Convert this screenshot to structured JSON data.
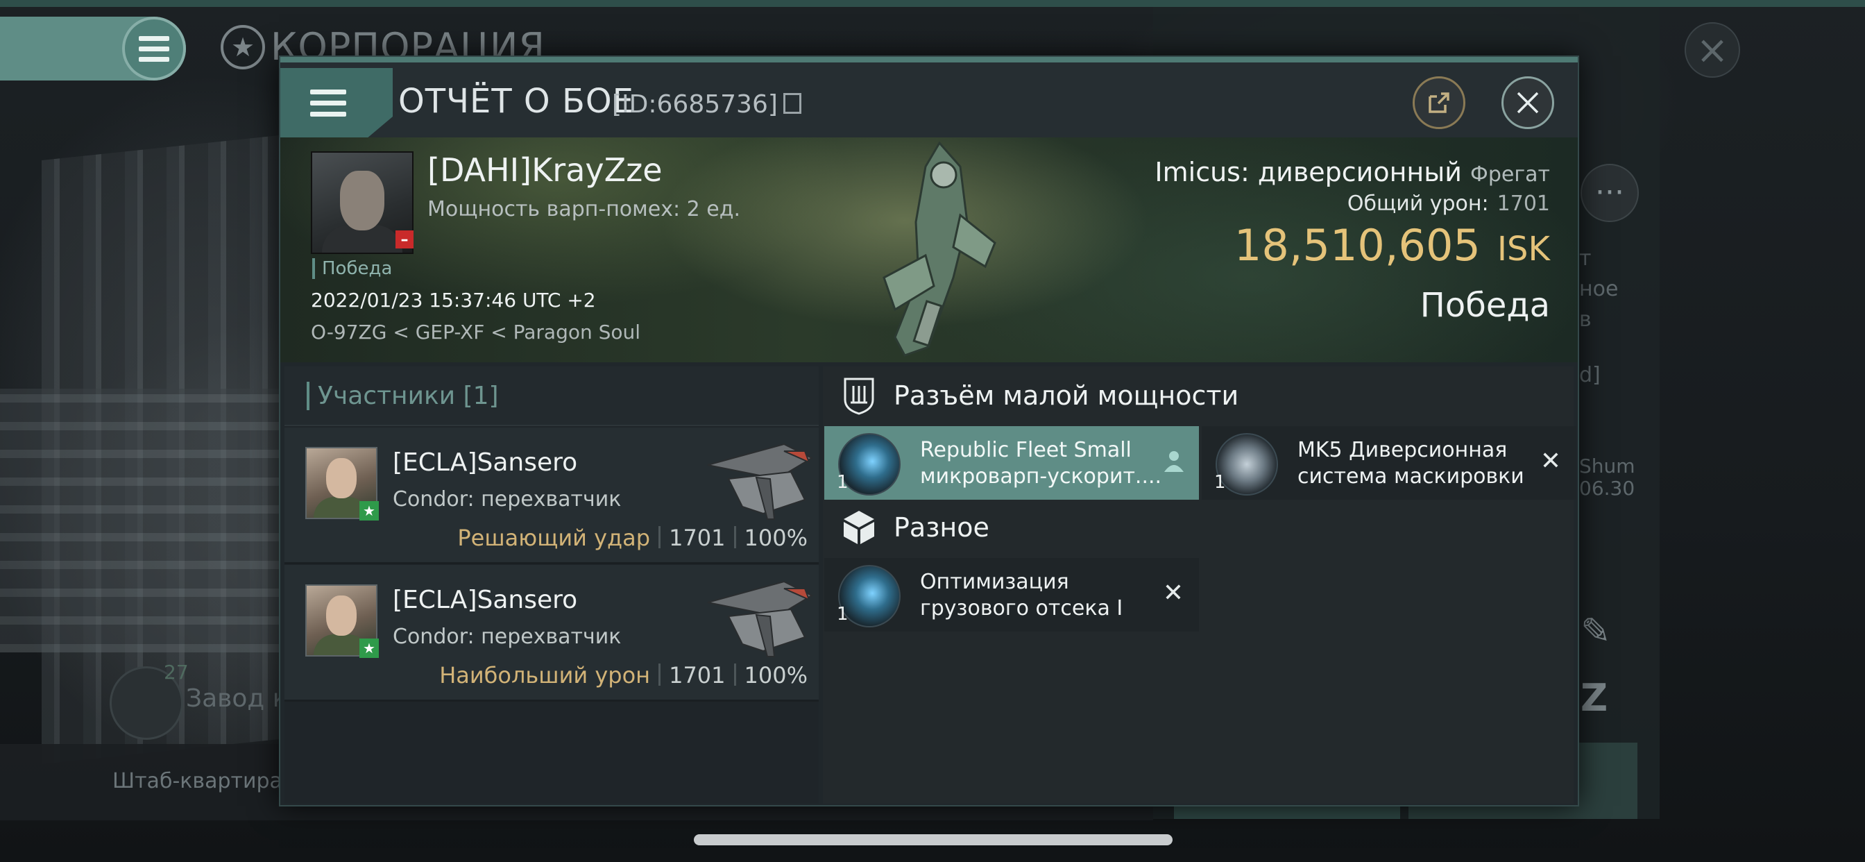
{
  "background": {
    "corp_title": "КОРПОРАЦИЯ",
    "factory_count": "27",
    "factory_label": "Завод к",
    "hq_label": "Штаб-квартира К",
    "right_texts": [
      "т",
      "ное",
      "в",
      "d]",
      "Shum",
      "06.30"
    ]
  },
  "report": {
    "title": "ОТЧЁТ О БОЕ",
    "id": "[ID:6685736]",
    "victim": {
      "name": "[DAHI]KrayZze",
      "warp_disrupt": "Мощность варп-помех: 2 ед.",
      "status_tag": "Победа",
      "datetime": "2022/01/23 15:37:46 UTC +2",
      "location": "O-97ZG < GEP-XF < Paragon Soul"
    },
    "ship": {
      "name": "Imicus: диверсионный",
      "class": "Фрегат",
      "total_damage_label": "Общий урон:",
      "total_damage": "1701",
      "isk_value": "18,510,605",
      "isk_unit": "ISK",
      "result": "Победа"
    },
    "participants": {
      "label": "Участники [1]",
      "rows": [
        {
          "name": "[ECLA]Sansero",
          "ship": "Condor: перехватчик",
          "role": "Решающий удар",
          "damage": "1701",
          "percent": "100%"
        },
        {
          "name": "[ECLA]Sansero",
          "ship": "Condor: перехватчик",
          "role": "Наибольший урон",
          "damage": "1701",
          "percent": "100%"
        }
      ]
    },
    "fitting": {
      "low_slot_title": "Разъём малой мощности",
      "misc_title": "Разное",
      "modules": [
        {
          "line1": "Republic Fleet Small",
          "line2": "микроварп-ускорит....",
          "qty": "1"
        },
        {
          "line1": "MK5 Диверсионная",
          "line2": "система маскировки",
          "qty": "1"
        },
        {
          "line1": "Оптимизация",
          "line2": "грузового отсека I",
          "qty": "1"
        }
      ]
    }
  }
}
